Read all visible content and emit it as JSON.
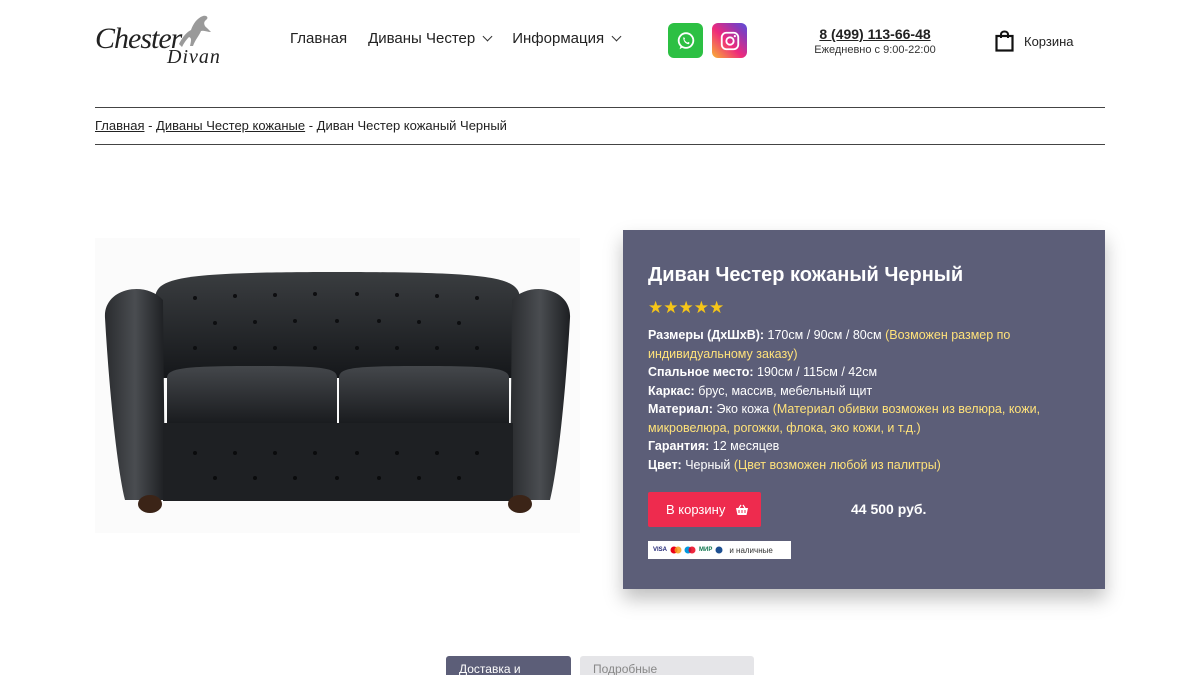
{
  "logo": {
    "word1": "Chester",
    "word2": "Divan"
  },
  "nav": [
    {
      "label": "Главная",
      "has_dropdown": false
    },
    {
      "label": "Диваны Честер",
      "has_dropdown": true
    },
    {
      "label": "Информация",
      "has_dropdown": true
    }
  ],
  "social": {
    "whatsapp": "whatsapp-icon",
    "instagram": "instagram-icon"
  },
  "contact": {
    "phone": "8 (499) 113-66-48",
    "hours": "Ежедневно с 9:00-22:00"
  },
  "cart": {
    "label": "Корзина"
  },
  "breadcrumb": {
    "home": "Главная",
    "sep": " - ",
    "category": "Диваны Честер кожаные",
    "current": "Диван Честер кожаный Черный"
  },
  "product": {
    "title": "Диван Честер кожаный Черный",
    "rating": 5,
    "stars": "★★★★★",
    "specs": {
      "size_label": "Размеры (ДхШхВ):",
      "size_value": "170см / 90см / 80см",
      "size_note": "(Возможен размер по индивидуальному заказу)",
      "sleep_label": "Спальное место:",
      "sleep_value": "190см / 115см / 42см",
      "frame_label": "Каркас:",
      "frame_value": "брус, массив, мебельный щит",
      "material_label": "Материал:",
      "material_value": "Эко кожа",
      "material_note": "(Материал обивки возможен из велюра, кожи, микровелюра, рогожки, флока, эко кожи, и т.д.)",
      "warranty_label": "Гарантия:",
      "warranty_value": "12 месяцев",
      "color_label": "Цвет:",
      "color_value": "Черный",
      "color_note": "(Цвет возможен любой из палитры)"
    },
    "buy_label": "В корзину",
    "price": "44 500 руб.",
    "payments": {
      "visa": "VISA",
      "mir": "МИР",
      "cash": "и наличные"
    }
  },
  "tabs": [
    {
      "label": "Доставка и оплата",
      "active": true
    },
    {
      "label": "Подробные характеристики",
      "active": false
    }
  ],
  "colors": {
    "panel": "#5c5e78",
    "buy": "#ee2b4e",
    "highlight": "#ffe27a",
    "star": "#f5c518"
  }
}
